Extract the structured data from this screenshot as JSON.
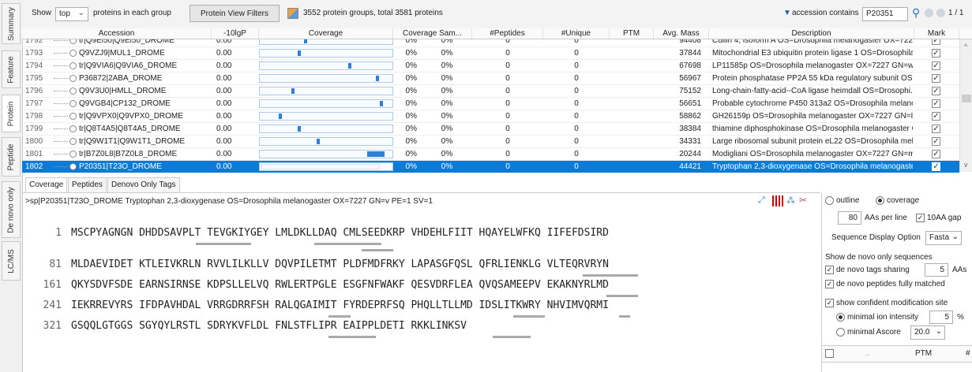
{
  "vtabs": [
    "Summary",
    "Feature",
    "Protein",
    "Peptide",
    "De novo only",
    "LC/MS"
  ],
  "toolbar": {
    "show_label": "Show",
    "show_value": "top",
    "show_suffix": "proteins in each group",
    "filters_button": "Protein View Filters",
    "summary": "3552 protein groups, total 3581 proteins",
    "filter_field": "accession contains",
    "filter_value": "P20351",
    "page": "1 / 1"
  },
  "table": {
    "columns": [
      "Accession",
      "-10lgP",
      "Coverage",
      "Coverage Sam...",
      "#Peptides",
      "#Unique",
      "PTM",
      "Avg. Mass",
      "Description",
      "Mark"
    ],
    "rows": [
      {
        "n": "1792",
        "acc": "tr|Q9Ei50|Q9Ei50_DROME",
        "score": "0.00",
        "cov": 0.35,
        "pct": "0%",
        "covs": "0%",
        "peps": "0",
        "uniq": "0",
        "mass": "94408",
        "desc": "Cullin 4, isoform A OS=Drosophila melanogaster OX=7227...",
        "sel": false,
        "partial": true
      },
      {
        "n": "1793",
        "acc": "Q9VZJ9|MUL1_DROME",
        "score": "0.00",
        "cov": 0.3,
        "pct": "0%",
        "covs": "0%",
        "peps": "0",
        "uniq": "0",
        "mass": "37844",
        "desc": "Mitochondrial E3 ubiquitin protein ligase 1 OS=Drosophila",
        "sel": false
      },
      {
        "n": "1794",
        "acc": "tr|Q9VIA6|Q9VIA6_DROME",
        "score": "0.00",
        "cov": 0.7,
        "pct": "0%",
        "covs": "0%",
        "peps": "0",
        "uniq": "0",
        "mass": "67698",
        "desc": "LP11585p OS=Drosophila melanogaster OX=7227 GN=wa-...",
        "sel": false
      },
      {
        "n": "1795",
        "acc": "P36872|2ABA_DROME",
        "score": "0.00",
        "cov": 0.92,
        "pct": "0%",
        "covs": "0%",
        "peps": "0",
        "uniq": "0",
        "mass": "56967",
        "desc": "Protein phosphatase PP2A 55 kDa regulatory subunit OS=...",
        "sel": false
      },
      {
        "n": "1796",
        "acc": "Q9V3U0|HMLL_DROME",
        "score": "0.00",
        "cov": 0.25,
        "pct": "0%",
        "covs": "0%",
        "peps": "0",
        "uniq": "0",
        "mass": "75152",
        "desc": "Long-chain-fatty-acid--CoA ligase heimdall OS=Drosophi...",
        "sel": false
      },
      {
        "n": "1797",
        "acc": "Q9VGB4|CP132_DROME",
        "score": "0.00",
        "cov": 0.95,
        "pct": "0%",
        "covs": "0%",
        "peps": "0",
        "uniq": "0",
        "mass": "56651",
        "desc": "Probable cytochrome P450 313a2 OS=Drosophila melanog...",
        "sel": false
      },
      {
        "n": "1798",
        "acc": "tr|Q9VPX0|Q9VPX0_DROME",
        "score": "0.00",
        "cov": 0.15,
        "pct": "0%",
        "covs": "0%",
        "peps": "0",
        "uniq": "0",
        "mass": "58862",
        "desc": "GH26159p OS=Drosophila melanogaster OX=7227 GN=Iris...",
        "sel": false
      },
      {
        "n": "1799",
        "acc": "tr|Q8T4A5|Q8T4A5_DROME",
        "score": "0.00",
        "cov": 0.3,
        "pct": "0%",
        "covs": "0%",
        "peps": "0",
        "uniq": "0",
        "mass": "38384",
        "desc": "thiamine diphosphokinase OS=Drosophila melanogaster O...",
        "sel": false
      },
      {
        "n": "1800",
        "acc": "tr|Q9W1T1|Q9W1T1_DROME",
        "score": "0.00",
        "cov": 0.45,
        "pct": "0%",
        "covs": "0%",
        "peps": "0",
        "uniq": "0",
        "mass": "34331",
        "desc": "Large ribosomal subunit protein eL22 OS=Drosophila mela...",
        "sel": false
      },
      {
        "n": "1801",
        "acc": "tr|B7Z0L8|B7Z0L8_DROME",
        "score": "0.00",
        "cov": 0.85,
        "pct": "0%",
        "covs": "0%",
        "peps": "0",
        "uniq": "0",
        "mass": "20244",
        "desc": "Modigliani OS=Drosophila melanogaster OX=7227 GN=moi...",
        "sel": false
      },
      {
        "n": "1802",
        "acc": "P20351|T23O_DROME",
        "score": "0.00",
        "cov": 0.1,
        "pct": "0%",
        "covs": "0%",
        "peps": "0",
        "uniq": "0",
        "mass": "44421",
        "desc": "Tryptophan 2,3-dioxygenase OS=Drosophila melanogaster ...",
        "sel": true
      }
    ]
  },
  "bottom_tabs": [
    "Coverage",
    "Peptides",
    "Denovo Only Tags"
  ],
  "protein_header": ">sp|P20351|T23O_DROME Tryptophan 2,3-dioxygenase OS=Drosophila melanogaster OX=7227 GN=v PE=1 SV=1",
  "sequence": [
    {
      "start": "1",
      "text": "MSCPYAGNGN DHDDSAVPLT TEVGKIYGEY LMLDKLLDAQ CMLSEEDKRP VHDEHLFIIT HQAYELWFKQ IIFEFDSIRD"
    },
    {
      "start": "81",
      "text": "MLDAEVIDET KTLEIVKRLN RVVLILKLLV DQVPILETMT PLDFMDFRKY LAPASGFQSL QFRLIENKLG VLTEQRVRYN"
    },
    {
      "start": "161",
      "text": "QKYSDVFSDE EARNSIRNSE KDPSLLELVQ RWLERTPGLE ESGFNFWAKF QESVDRFLEA QVQSAMEEPV EKAKNYRLMD"
    },
    {
      "start": "241",
      "text": "IEKRREVYRS IFDPAVHDAL VRRGDRRFSH RALQGAIMIT FYRDEPRFSQ PHQLLTLLMD IDSLITKWRY NHVIMVQRMI"
    },
    {
      "start": "321",
      "text": "GSQQLGTGGS SGYQYLRSTL SDRYKVFLDL FNLSTFLIPR EAIPPLDETI RKKLINKSV"
    }
  ],
  "right_panel": {
    "outline": "outline",
    "coverage": "coverage",
    "aas_per_line_value": "80",
    "aas_per_line": "AAs per line",
    "gap_label": "10AA gap",
    "seq_display_label": "Sequence Display Option",
    "seq_display_value": "Fasta",
    "denovo_heading": "Show de novo only sequences",
    "tags_sharing": "de novo tags sharing",
    "tags_sharing_value": "5",
    "aas": "AAs",
    "fully_matched": "de novo peptides fully matched",
    "confident_mod": "show confident modification site",
    "min_ion": "minimal ion intensity",
    "min_ion_value": "5",
    "pct": "%",
    "min_ascore": "minimal Ascore",
    "min_ascore_value": "20.0",
    "ptm_col1": "..",
    "ptm_col2": "PTM",
    "ptm_col3": "#"
  },
  "colors": {
    "selection": "#0a7cd8",
    "coverage_fill": "#2f7fd8",
    "peptide_bar": "#a9a9a9"
  }
}
